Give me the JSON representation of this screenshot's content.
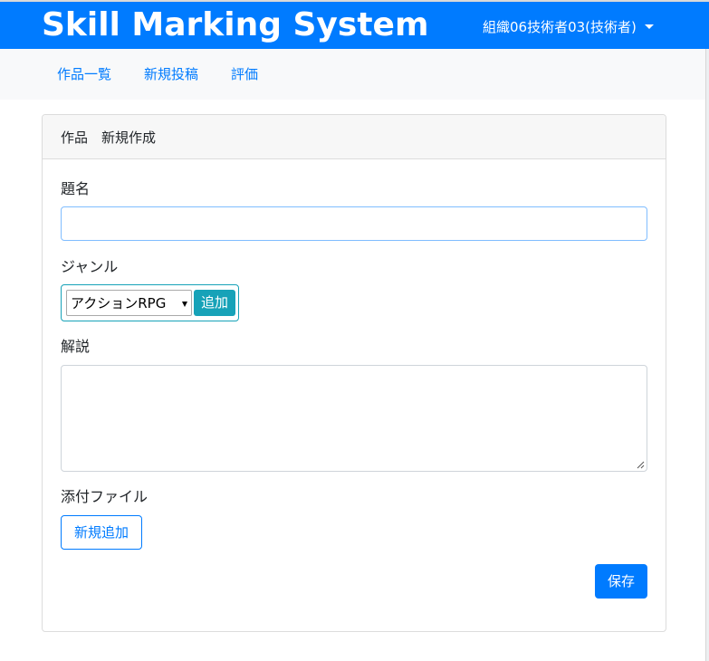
{
  "header": {
    "brand": "Skill Marking System",
    "user_menu_label": "組織06技術者03(技術者)",
    "user_menu_icon": "caret-down-icon"
  },
  "subnav": {
    "items": [
      {
        "label": "作品一覧"
      },
      {
        "label": "新規投稿"
      },
      {
        "label": "評価"
      }
    ]
  },
  "form": {
    "card_title": "作品　新規作成",
    "title_label": "題名",
    "title_value": "",
    "genre_label": "ジャンル",
    "genre_selected": "アクションRPG",
    "genre_add_button": "追加",
    "description_label": "解説",
    "description_value": "",
    "attachment_label": "添付ファイル",
    "attachment_add_button": "新規追加",
    "save_button": "保存"
  },
  "colors": {
    "primary": "#007bff",
    "info": "#17a2b8",
    "subnav_bg": "#f8f9fa"
  }
}
